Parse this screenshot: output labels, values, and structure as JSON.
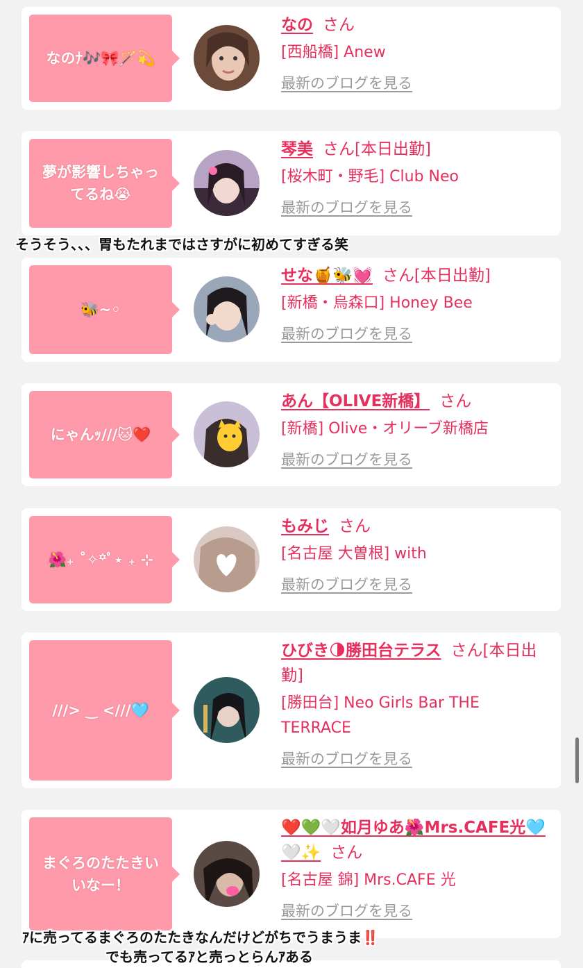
{
  "cards": [
    {
      "bubble": "なのﾅ🎶🎀🪄💫",
      "name": "なの",
      "suffix": "さん",
      "shop": "[西船橋] Anew",
      "blog": "最新のブログを見る"
    },
    {
      "bubble": "夢が影響しちゃってるね😭",
      "name": "琴美",
      "suffix": "さん[本日出勤]",
      "shop": "[桜木町・野毛] Club Neo",
      "blog": "最新のブログを見る"
    },
    {
      "bubble": "🐝~◦",
      "name": "せな🍯🐝💓",
      "suffix": "さん[本日出勤]",
      "shop": "[新橋・烏森口] Honey Bee",
      "blog": "最新のブログを見る"
    },
    {
      "bubble": "にゃんｯ///🐱❤️",
      "name": "あん【OLIVE新橋】",
      "suffix": "さん",
      "shop": "[新橋] Olive・オリーブ新橋店",
      "blog": "最新のブログを見る"
    },
    {
      "bubble": "🌺₊ ˚✧꙳ﾟ⋆ ₊ ⊹",
      "name": "もみじ",
      "suffix": "さん",
      "shop": "[名古屋 大曽根] with",
      "blog": "最新のブログを見る"
    },
    {
      "bubble": "///> ‿ <///🩵",
      "name": "ひびき🌗勝田台テラス",
      "suffix": "さん[本日出勤]",
      "shop": "[勝田台] Neo Girls Bar THE TERRACE",
      "blog": "最新のブログを見る"
    },
    {
      "bubble": "まぐろのたたきいいなー！",
      "name": "❤️💚🤍如月ゆあ🌺Mrs.CAFE光🩵🤍✨",
      "suffix": "さん",
      "shop": "[名古屋 錦] Mrs.CAFE 光",
      "blog": "最新のブログを見る"
    }
  ],
  "overlays": {
    "caption1": "そうそう、、、胃もたれまではさすがに初めてすぎる笑",
    "caption2a": "ｱに売ってるまぐろのたたきなんだけどがちでうまうま‼️",
    "caption2b": "でも売ってるｱと売っとらんｱある"
  },
  "colors": {
    "accent": "#e5305e",
    "bubble": "#ff9aaa",
    "link_gray": "#9a9a9a"
  }
}
